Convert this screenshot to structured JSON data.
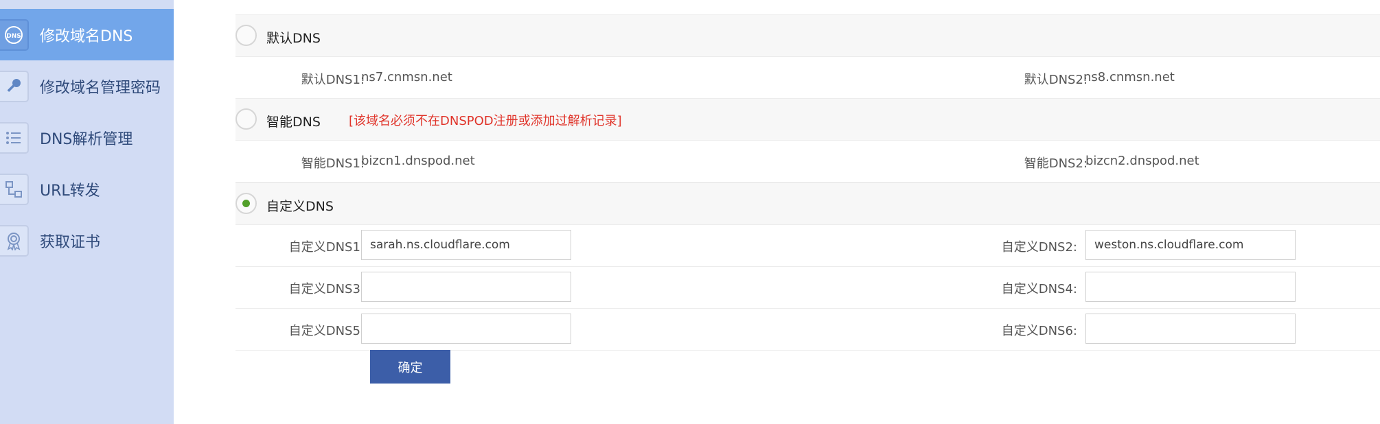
{
  "sidebar": {
    "items": [
      {
        "label": "修改域名DNS",
        "icon": "dns-icon",
        "active": true
      },
      {
        "label": "修改域名管理密码",
        "icon": "key-icon",
        "active": false
      },
      {
        "label": "DNS解析管理",
        "icon": "list-icon",
        "active": false
      },
      {
        "label": "URL转发",
        "icon": "redirect-icon",
        "active": false
      },
      {
        "label": "获取证书",
        "icon": "certificate-icon",
        "active": false
      }
    ]
  },
  "dns_options": {
    "default": {
      "label": "默认DNS",
      "checked": false,
      "dns1_label": "默认DNS1:",
      "dns1_value": "ns7.cnmsn.net",
      "dns2_label": "默认DNS2:",
      "dns2_value": "ns8.cnmsn.net"
    },
    "smart": {
      "label": "智能DNS",
      "note": "[该域名必须不在DNSPOD注册或添加过解析记录]",
      "checked": false,
      "dns1_label": "智能DNS1:",
      "dns1_value": "bizcn1.dnspod.net",
      "dns2_label": "智能DNS2:",
      "dns2_value": "bizcn2.dnspod.net"
    },
    "custom": {
      "label": "自定义DNS",
      "checked": true,
      "fields": [
        {
          "label": "自定义DNS1:",
          "value": "sarah.ns.cloudflare.com"
        },
        {
          "label": "自定义DNS2:",
          "value": "weston.ns.cloudflare.com"
        },
        {
          "label": "自定义DNS3:",
          "value": ""
        },
        {
          "label": "自定义DNS4:",
          "value": ""
        },
        {
          "label": "自定义DNS5:",
          "value": ""
        },
        {
          "label": "自定义DNS6:",
          "value": ""
        }
      ]
    }
  },
  "submit_label": "确定",
  "colors": {
    "sidebar_bg": "#d2dcf4",
    "sidebar_active": "#72a6ea",
    "note_red": "#e0342a",
    "radio_green": "#52a02a",
    "button_blue": "#3c5ea8"
  }
}
